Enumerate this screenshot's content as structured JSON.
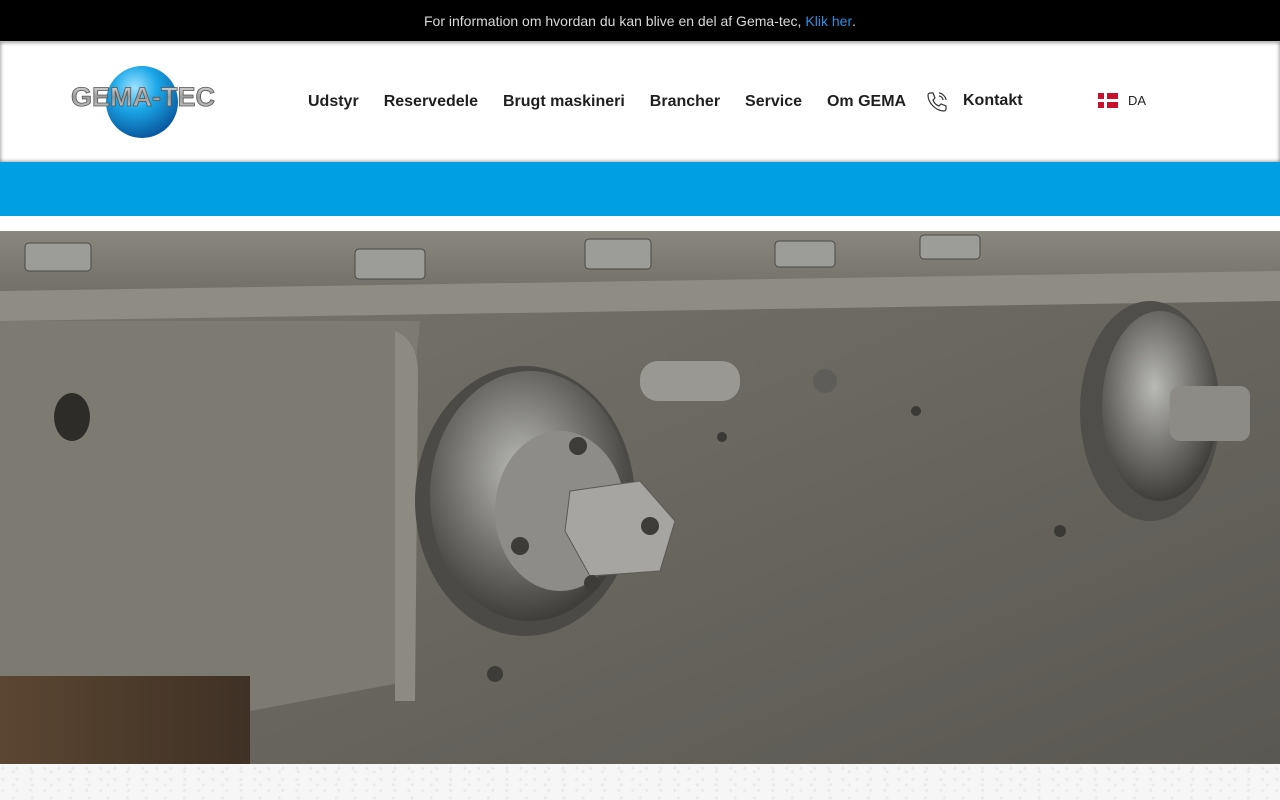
{
  "announcement": {
    "text": "For information om hvordan du kan blive en del af Gema-tec,",
    "link_text": "Klik her",
    "suffix": "."
  },
  "brand": {
    "logo_text": "GEMA-TEC",
    "accent_color": "#009fe3"
  },
  "nav": {
    "items": [
      {
        "label": "Udstyr"
      },
      {
        "label": "Reservedele"
      },
      {
        "label": "Brugt maskineri"
      },
      {
        "label": "Brancher"
      },
      {
        "label": "Service"
      },
      {
        "label": "Om GEMA"
      }
    ],
    "contact_label": "Kontakt",
    "phone_icon": "phone-icon"
  },
  "language": {
    "code": "DA",
    "flag_icon": "danish-flag-icon"
  }
}
